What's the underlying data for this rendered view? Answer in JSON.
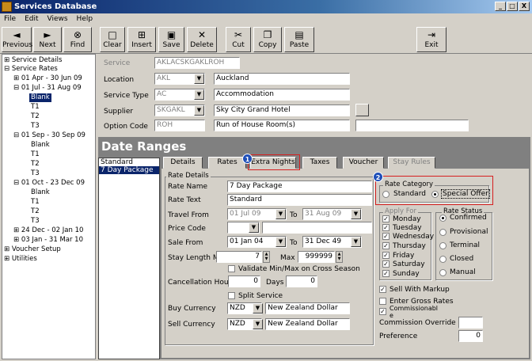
{
  "window": {
    "title": "Services Database",
    "min": "_",
    "max": "□",
    "close": "X"
  },
  "menu": [
    "File",
    "Edit",
    "Views",
    "Help"
  ],
  "toolbar": {
    "previous": "Previous",
    "next": "Next",
    "find": "Find",
    "clear": "Clear",
    "insert": "Insert",
    "save": "Save",
    "delete": "Delete",
    "cut": "Cut",
    "copy": "Copy",
    "paste": "Paste",
    "exit": "Exit"
  },
  "tree": {
    "service_details": "Service Details",
    "service_rates": "Service Rates",
    "r1": "01 Apr - 30 Jun 09",
    "r2": "01 Jul - 31 Aug 09",
    "blank1": "Blank",
    "t1a": "T1",
    "t2a": "T2",
    "t3a": "T3",
    "r3": "01 Sep - 30 Sep 09",
    "blank2": "Blank",
    "t1b": "T1",
    "t2b": "T2",
    "t3b": "T3",
    "r4": "01 Oct - 23 Dec 09",
    "blank3": "Blank",
    "t1c": "T1",
    "t2c": "T2",
    "t3c": "T3",
    "r5": "24 Dec - 02 Jan 10",
    "r6": "03 Jan - 31 Mar 10",
    "voucher_setup": "Voucher Setup",
    "utilities": "Utilities"
  },
  "service": {
    "service_label": "Service",
    "service_code": "AKLACSKGAKLROH",
    "location_label": "Location",
    "location_code": "AKL",
    "location_name": "Auckland",
    "type_label": "Service Type",
    "type_code": "AC",
    "type_name": "Accommodation",
    "supplier_label": "Supplier",
    "supplier_code": "SKGAKL",
    "supplier_name": "Sky City Grand Hotel",
    "option_label": "Option Code",
    "option_code": "ROH",
    "option_name": "Run of House Room(s)"
  },
  "section_title": "Date Ranges",
  "rate_list": [
    "Standard",
    "7 Day Package"
  ],
  "tabs": {
    "details": "Details",
    "rates": "Rates",
    "extra_nights": "Extra Nights",
    "taxes": "Taxes",
    "voucher": "Voucher",
    "stay_rules": "Stay Rules"
  },
  "badges": {
    "b1": "1",
    "b2": "2"
  },
  "details": {
    "group_title": "Rate Details",
    "rate_name_label": "Rate Name",
    "rate_name": "7 Day Package",
    "rate_text_label": "Rate Text",
    "rate_text": "Standard",
    "travel_from_label": "Travel From",
    "travel_from": "01 Jul 09",
    "to1": "To",
    "travel_to": "31 Aug 09",
    "price_code_label": "Price Code",
    "sale_from_label": "Sale From",
    "sale_from": "01 Jan 04",
    "to2": "To",
    "sale_to": "31 Dec 49",
    "stay_min_label": "Stay Length Min",
    "stay_min": "7",
    "max_label": "Max",
    "stay_max": "999999",
    "validate_label": "Validate Min/Max on Cross Season",
    "cancel_label": "Cancellation Hours",
    "cancel_hours": "0",
    "days_label": "Days",
    "cancel_days": "0",
    "split_label": "Split Service",
    "buy_label": "Buy Currency",
    "buy_code": "NZD",
    "buy_name": "New Zealand Dollar",
    "sell_label": "Sell Currency",
    "sell_code": "NZD",
    "sell_name": "New Zealand Dollar"
  },
  "rate_category": {
    "title": "Rate Category",
    "standard": "Standard",
    "special": "Special Offer",
    "selected": "Special Offer"
  },
  "apply_for": {
    "title": "Apply For",
    "days": [
      "Monday",
      "Tuesday",
      "Wednesday",
      "Thursday",
      "Friday",
      "Saturday",
      "Sunday"
    ]
  },
  "rate_status": {
    "title": "Rate Status",
    "options": [
      "Confirmed",
      "Provisional",
      "Terminal",
      "Closed",
      "Manual"
    ],
    "selected": "Confirmed"
  },
  "extras": {
    "sell_markup": "Sell With Markup",
    "gross_rates": "Enter Gross Rates",
    "commission1": "Commissionabl",
    "commission2": "e",
    "override_label": "Commission Override",
    "preference_label": "Preference",
    "preference": "0"
  }
}
